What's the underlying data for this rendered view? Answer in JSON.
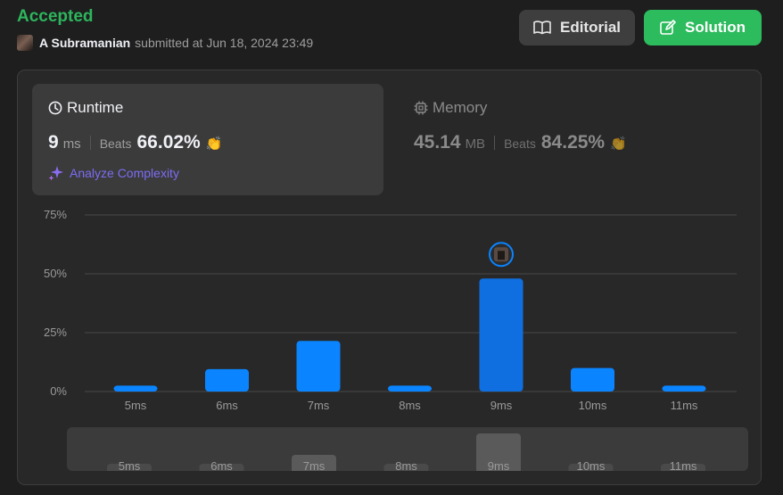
{
  "status": "Accepted",
  "submission": {
    "user": "A Subramanian",
    "text": "submitted at Jun 18, 2024 23:49"
  },
  "buttons": {
    "editorial": "Editorial",
    "solution": "Solution"
  },
  "runtime": {
    "title": "Runtime",
    "value": "9",
    "unit": "ms",
    "beats_label": "Beats",
    "beats": "66.02%",
    "analyze": "Analyze Complexity"
  },
  "memory": {
    "title": "Memory",
    "value": "45.14",
    "unit": "MB",
    "beats_label": "Beats",
    "beats": "84.25%"
  },
  "colors": {
    "accent": "#2cbb5d",
    "bar": "#0a84ff",
    "bar_selected": "#0f6fe0",
    "analyze": "#7b6df2"
  },
  "chart_data": {
    "type": "bar",
    "categories": [
      "5ms",
      "6ms",
      "7ms",
      "8ms",
      "9ms",
      "10ms",
      "11ms"
    ],
    "values": [
      2.5,
      9.5,
      21.5,
      2.5,
      48,
      10,
      2.5
    ],
    "selected": "9ms",
    "yticks": [
      "0%",
      "25%",
      "50%",
      "75%"
    ],
    "ytick_values": [
      0,
      25,
      50,
      75
    ],
    "ylim": [
      0,
      75
    ],
    "grid": true
  },
  "minimap": {
    "categories": [
      "5ms",
      "6ms",
      "7ms",
      "8ms",
      "9ms",
      "10ms",
      "11ms"
    ],
    "highlighted": [
      "7ms",
      "9ms"
    ]
  }
}
